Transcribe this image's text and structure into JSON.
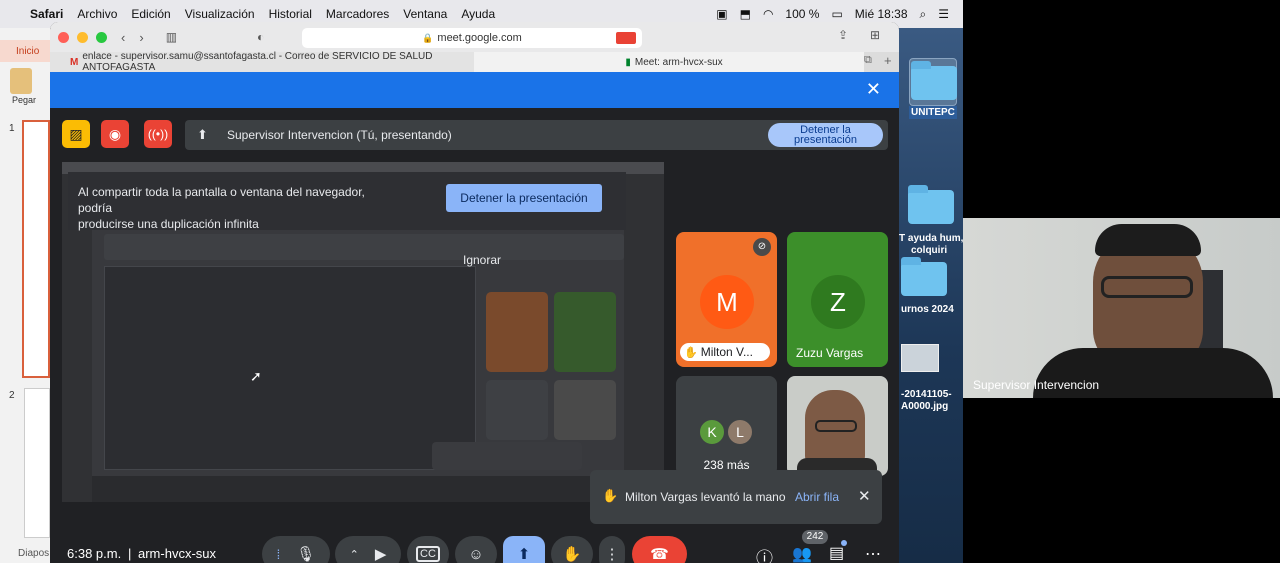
{
  "menubar": {
    "app": "Safari",
    "items": [
      "Archivo",
      "Edición",
      "Visualización",
      "Historial",
      "Marcadores",
      "Ventana",
      "Ayuda"
    ],
    "battery": "100 %",
    "clock": "Mié 18:38"
  },
  "ppt": {
    "tab_label": "Inicio",
    "paste_label": "Pegar",
    "slide1_num": "1",
    "slide2_num": "2",
    "status": "Diapos"
  },
  "safari": {
    "url": "meet.google.com",
    "tab1": "enlace - supervisor.samu@ssantofagasta.cl - Correo de SERVICIO DE SALUD ANTOFAGASTA",
    "tab2": "Meet: arm-hvcx-sux"
  },
  "presenting": {
    "title": "Supervisor Intervencion (Tú, presentando)",
    "stop_label_1": "Detener la",
    "stop_label_2": "presentación"
  },
  "warning": {
    "text_line1": "Al compartir toda la pantalla o ventana del navegador, podría",
    "text_line2": "producirse una duplicación infinita",
    "stop_button": "Detener la presentación",
    "ignore_button": "Ignorar"
  },
  "participants": {
    "milton_initial": "M",
    "milton_name": "Milton V...",
    "zuzu_initial": "Z",
    "zuzu_name": "Zuzu Vargas",
    "k_initial": "K",
    "l_initial": "L",
    "more_label": "238 más"
  },
  "notification": {
    "text": "Milton Vargas levantó la mano",
    "action": "Abrir fila"
  },
  "bottom": {
    "time": "6:38 p.m.",
    "separator": "|",
    "meeting_code": "arm-hvcx-sux",
    "people_count": "242"
  },
  "desktop": {
    "label1": "UNITEPC",
    "label2": "T ayuda hum,",
    "label2b": "colquiri",
    "label3": "urnos 2024",
    "label4": "-20141105-",
    "label4b": "A0000.jpg"
  },
  "selfcam": {
    "name": "Supervisor Intervencion"
  },
  "colors": {
    "meet_bg": "#202124",
    "accent_blue": "#1a73e8",
    "stop_btn": "#a8c7fa",
    "milton_tile": "#f0702a",
    "zuzu_tile": "#3c8f2a",
    "end_call": "#ea4335"
  }
}
